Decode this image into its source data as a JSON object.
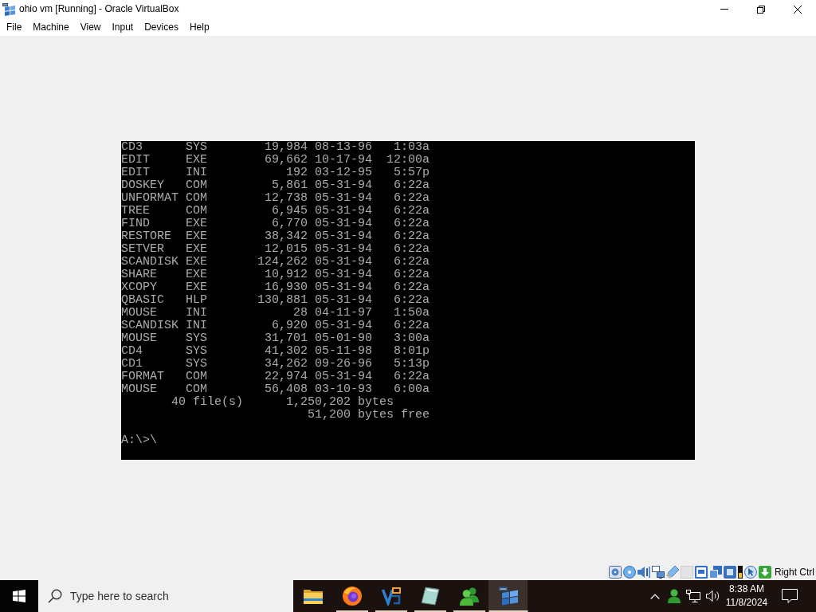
{
  "window": {
    "title": "ohio vm [Running] - Oracle VirtualBox"
  },
  "menu_bar": [
    "File",
    "Machine",
    "View",
    "Input",
    "Devices",
    "Help"
  ],
  "vm_screen": {
    "entries": [
      {
        "name": "CD3",
        "ext": "SYS",
        "size": "19,984",
        "date": "08-13-96",
        "time": "1:03a"
      },
      {
        "name": "EDIT",
        "ext": "EXE",
        "size": "69,662",
        "date": "10-17-94",
        "time": "12:00a"
      },
      {
        "name": "EDIT",
        "ext": "INI",
        "size": "192",
        "date": "03-12-95",
        "time": "5:57p"
      },
      {
        "name": "DOSKEY",
        "ext": "COM",
        "size": "5,861",
        "date": "05-31-94",
        "time": "6:22a"
      },
      {
        "name": "UNFORMAT",
        "ext": "COM",
        "size": "12,738",
        "date": "05-31-94",
        "time": "6:22a"
      },
      {
        "name": "TREE",
        "ext": "COM",
        "size": "6,945",
        "date": "05-31-94",
        "time": "6:22a"
      },
      {
        "name": "FIND",
        "ext": "EXE",
        "size": "6,770",
        "date": "05-31-94",
        "time": "6:22a"
      },
      {
        "name": "RESTORE",
        "ext": "EXE",
        "size": "38,342",
        "date": "05-31-94",
        "time": "6:22a"
      },
      {
        "name": "SETVER",
        "ext": "EXE",
        "size": "12,015",
        "date": "05-31-94",
        "time": "6:22a"
      },
      {
        "name": "SCANDISK",
        "ext": "EXE",
        "size": "124,262",
        "date": "05-31-94",
        "time": "6:22a"
      },
      {
        "name": "SHARE",
        "ext": "EXE",
        "size": "10,912",
        "date": "05-31-94",
        "time": "6:22a"
      },
      {
        "name": "XCOPY",
        "ext": "EXE",
        "size": "16,930",
        "date": "05-31-94",
        "time": "6:22a"
      },
      {
        "name": "QBASIC",
        "ext": "HLP",
        "size": "130,881",
        "date": "05-31-94",
        "time": "6:22a"
      },
      {
        "name": "MOUSE",
        "ext": "INI",
        "size": "28",
        "date": "04-11-97",
        "time": "1:50a"
      },
      {
        "name": "SCANDISK",
        "ext": "INI",
        "size": "6,920",
        "date": "05-31-94",
        "time": "6:22a"
      },
      {
        "name": "MOUSE",
        "ext": "SYS",
        "size": "31,701",
        "date": "05-01-90",
        "time": "3:00a"
      },
      {
        "name": "CD4",
        "ext": "SYS",
        "size": "41,302",
        "date": "05-11-98",
        "time": "8:01p"
      },
      {
        "name": "CD1",
        "ext": "SYS",
        "size": "34,262",
        "date": "09-26-96",
        "time": "5:13p"
      },
      {
        "name": "FORMAT",
        "ext": "COM",
        "size": "22,974",
        "date": "05-31-94",
        "time": "6:22a"
      },
      {
        "name": "MOUSE",
        "ext": "COM",
        "size": "56,408",
        "date": "03-10-93",
        "time": "6:00a"
      }
    ],
    "file_count": "40 file(s)",
    "total_size": "1,250,202 bytes",
    "free_space": "51,200 bytes free",
    "prompt": "A:\\>\\"
  },
  "status_bar": {
    "host_key": "Right Ctrl"
  },
  "taskbar": {
    "search": {
      "placeholder": "Type here to search"
    },
    "apps": [
      {
        "kind": "folder",
        "running": false,
        "selected": false
      },
      {
        "kind": "globe",
        "running": true,
        "selected": false
      },
      {
        "kind": "vshape",
        "running": true,
        "selected": false
      },
      {
        "kind": "slate",
        "running": true,
        "selected": false
      },
      {
        "kind": "people",
        "running": true,
        "selected": false
      },
      {
        "kind": "panes",
        "running": true,
        "selected": true
      }
    ],
    "clock": {
      "time": "8:38 AM",
      "date": "11/8/2024"
    }
  }
}
